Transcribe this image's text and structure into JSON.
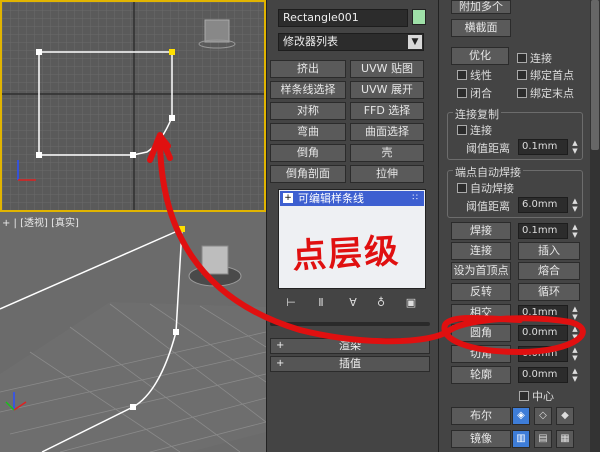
{
  "viewport_persp": {
    "label": "+ | [透视] [真实]"
  },
  "object": {
    "name": "Rectangle001",
    "color": "#9fe0a8"
  },
  "modifier_list": {
    "label": "修改器列表",
    "arrow": "▼"
  },
  "modifier_buttons": [
    [
      "挤出",
      "UVW 贴图"
    ],
    [
      "样条线选择",
      "UVW 展开"
    ],
    [
      "对称",
      "FFD 选择"
    ],
    [
      "弯曲",
      "曲面选择"
    ],
    [
      "倒角",
      "壳"
    ],
    [
      "倒角剖面",
      "拉伸"
    ]
  ],
  "stack": {
    "item": "可编辑样条线",
    "plus": "+",
    "dots": "∷"
  },
  "stack_tools": [
    "⊢",
    "Ⅱ",
    "∀",
    "♁",
    "▣"
  ],
  "rollouts": [
    {
      "pm": "+",
      "label": "渲染"
    },
    {
      "pm": "+",
      "label": "插值"
    }
  ],
  "right_panel": {
    "top_btn": "附加多个",
    "top_btn2": "横截面",
    "opt_btn": "优化",
    "opt_connect": "连接",
    "cb_linear": "线性",
    "cb_bind_first": "绑定首点",
    "cb_closed": "闭合",
    "cb_bind_last": "绑定末点",
    "copy_group": {
      "title": "连接复制",
      "connect": "连接",
      "threshold_label": "阈值距离",
      "threshold_value": "0.1mm"
    },
    "weld_group": {
      "title": "端点自动焊接",
      "auto_weld": "自动焊接",
      "threshold_label": "阈值距离",
      "threshold_value": "6.0mm"
    },
    "rows": [
      {
        "left": "焊接",
        "right_value": "0.1mm"
      },
      {
        "left": "连接",
        "right_btn": "插入"
      },
      {
        "left": "设为首顶点",
        "right_btn": "熔合"
      },
      {
        "left": "反转",
        "right_btn": "循环"
      },
      {
        "left": "相交",
        "right_value": "0.1mm"
      },
      {
        "left": "圆角",
        "right_value": "0.0mm"
      },
      {
        "left": "切角",
        "right_value": "0.0mm"
      },
      {
        "left": "轮廓",
        "right_value": "0.0mm"
      }
    ],
    "center_cb": "中心",
    "boolean_btn": "布尔",
    "mirror_btn": "镜像"
  },
  "annotation": {
    "text": "点层级",
    "color": "#e01010"
  }
}
